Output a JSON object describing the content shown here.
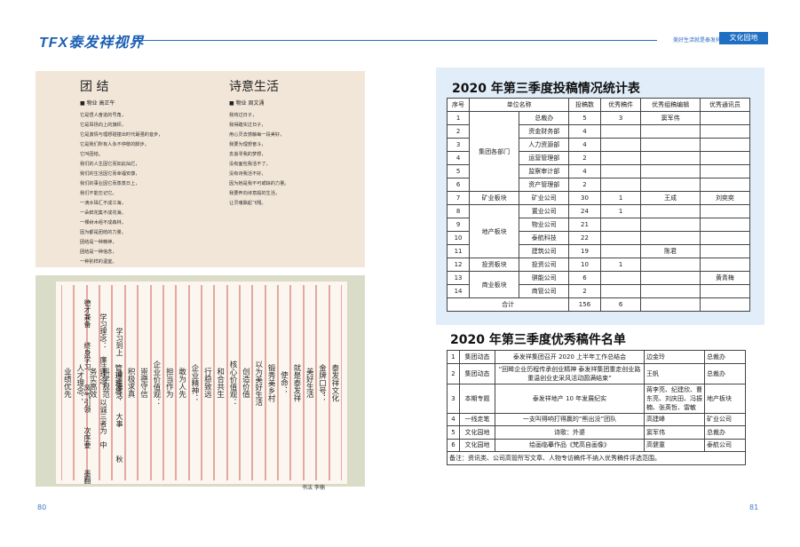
{
  "header": {
    "logo_tfx": "TFX",
    "logo_rest": "泰发祥视界",
    "slogan": "美好生活就是泰发祥",
    "section_tab": "文化园地"
  },
  "poems": [
    {
      "title": "团 结",
      "author": "■ 物业 高正午",
      "lines": [
        "它是悟人奋进的号角，",
        "它是昂扬向上的旗帜，",
        "它是激情与理想碰撞出时代最强的音步，",
        "它是我们所有人永不停歇的脚步，",
        "它叫团结。",
        "我们的人生因它而如此灿烂，",
        "我们的生活因它而幸福安康，",
        "我们的事业因它而蒸蒸日上，",
        "我们不能忘记它。",
        "一滴水珠汇不成江海，",
        "一朵鲜花集不成花海，",
        "一棵树木组不成森林，",
        "因为都是团结的力量。",
        "团结是一种精神，",
        "团结是一种信念，",
        "一种别样的温室。"
      ]
    },
    {
      "title": "诗意生活",
      "author": "■ 物业 周文涌",
      "lines": [
        "我将过日子，",
        "我得踏实过日子，",
        "用心灵去感触每一段美好，",
        "我要为理想奋斗，",
        "去追寻我的梦想，",
        "没有面包我活不了，",
        "没有诗我活不好，",
        "因为她是我不可或缺的力量。",
        "我要奔向诗意般的生活，",
        "让灵魂飘起飞翔。"
      ]
    }
  ],
  "calligraphy": {
    "columns": [
      "泰发祥文化",
      "金牌口号：",
      "美好生活",
      "就是泰发祥",
      "使命：",
      "锻秀美乡村",
      "以为美好生活",
      "创造价值",
      "核心价值观：",
      "和合共生",
      "行稳致远",
      "企业精神：",
      "敢为人先",
      "担当作为",
      "企业价值观：",
      "崇德守信",
      "积极求真",
      "管理理念：",
      "科学规范",
      "务实高效",
      "人才理念：",
      "业绩优先",
      "德才兼备",
      "学习理念：",
      "学习到上",
      "终身学习",
      "廉洁理念：",
      "清正廉洁",
      "风气引领",
      "以诚三者为",
      "大事",
      "次序要",
      "中",
      "秋",
      "墨翻"
    ],
    "credit": "书法 李楠"
  },
  "stats": {
    "title": "2020 年第三季度投稿情况统计表",
    "headers": [
      "序号",
      "单位名称",
      "投稿数",
      "优秀稿件",
      "优秀组稿编辑",
      "优秀通讯员"
    ],
    "rows": [
      {
        "no": "1",
        "group": "集团各部门",
        "unit": "总裁办",
        "count": "5",
        "excel": "3",
        "editor": "窦军伟",
        "corr": ""
      },
      {
        "no": "2",
        "group": "",
        "unit": "资金财务部",
        "count": "4",
        "excel": "",
        "editor": "",
        "corr": ""
      },
      {
        "no": "3",
        "group": "",
        "unit": "人力资源部",
        "count": "4",
        "excel": "",
        "editor": "",
        "corr": ""
      },
      {
        "no": "4",
        "group": "",
        "unit": "运营管理部",
        "count": "2",
        "excel": "",
        "editor": "",
        "corr": ""
      },
      {
        "no": "5",
        "group": "",
        "unit": "监察审计部",
        "count": "4",
        "excel": "",
        "editor": "",
        "corr": ""
      },
      {
        "no": "6",
        "group": "",
        "unit": "资产管理部",
        "count": "2",
        "excel": "",
        "editor": "",
        "corr": ""
      },
      {
        "no": "7",
        "group": "矿业板块",
        "unit": "矿业公司",
        "count": "30",
        "excel": "1",
        "editor": "王成",
        "corr": "刘奕奕"
      },
      {
        "no": "8",
        "group": "地产板块",
        "unit": "置业公司",
        "count": "24",
        "excel": "1",
        "editor": "",
        "corr": ""
      },
      {
        "no": "9",
        "group": "",
        "unit": "物业公司",
        "count": "21",
        "excel": "",
        "editor": "",
        "corr": ""
      },
      {
        "no": "10",
        "group": "",
        "unit": "泰航科技",
        "count": "22",
        "excel": "",
        "editor": "",
        "corr": ""
      },
      {
        "no": "11",
        "group": "",
        "unit": "建筑公司",
        "count": "19",
        "excel": "",
        "editor": "陈君",
        "corr": ""
      },
      {
        "no": "12",
        "group": "投资板块",
        "unit": "投资公司",
        "count": "10",
        "excel": "1",
        "editor": "",
        "corr": ""
      },
      {
        "no": "13",
        "group": "商业板块",
        "unit": "骐能公司",
        "count": "6",
        "excel": "",
        "editor": "",
        "corr": "黄青梅"
      },
      {
        "no": "14",
        "group": "",
        "unit": "商管公司",
        "count": "2",
        "excel": "",
        "editor": "",
        "corr": ""
      }
    ],
    "total_label": "合计",
    "total_count": "156",
    "total_excel": "6"
  },
  "excellent": {
    "title": "2020 年第三季度优秀稿件名单",
    "rows": [
      {
        "no": "1",
        "col": "集团动态",
        "title": "泰发祥集团召开 2020 上半年工作总结会",
        "author": "边金玲",
        "unit": "总裁办"
      },
      {
        "no": "2",
        "col": "集团动态",
        "title": "“回眸企业历程传承创业精神 泰发祥集团重走创业路重温创业史采风活动圆满结束”",
        "author": "王帆",
        "unit": "总裁办"
      },
      {
        "no": "3",
        "col": "本期专题",
        "title": "泰发祥地产 10 年发展纪实",
        "author": "蒋李亮、纪建欣、曹东亮、刘庆田、冯振楠、张英哲、雷敏",
        "unit": "地产板块"
      },
      {
        "no": "4",
        "col": "一线走笔",
        "title": "一支叫得响打得赢的“熊出没”团队",
        "author": "高建峰",
        "unit": "矿业公司"
      },
      {
        "no": "5",
        "col": "文化园地",
        "title": "诗歌：外婆",
        "author": "窦军伟",
        "unit": "总裁办"
      },
      {
        "no": "6",
        "col": "文化园地",
        "title": "绘画临摹作品《梵高自画像》",
        "author": "高健童",
        "unit": "泰航公司"
      }
    ],
    "note": "备注：资讯类、公司高管所写文章、人物专访稿件不纳入优秀稿件评选范围。"
  },
  "pages": {
    "left": "80",
    "right": "81"
  }
}
